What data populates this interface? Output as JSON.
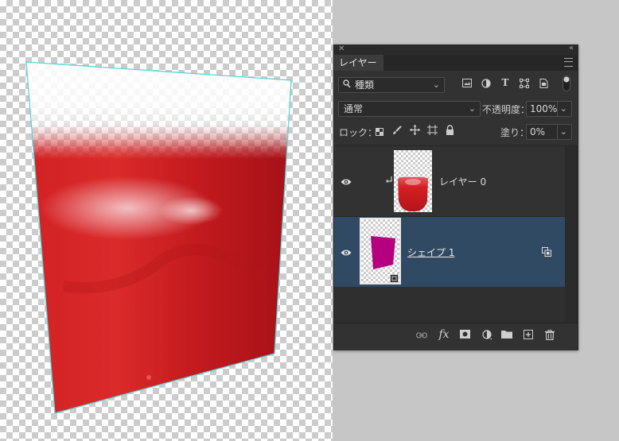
{
  "panel": {
    "tab_label": "レイヤー",
    "filter_kind": "種類",
    "blend_mode": "通常",
    "opacity_label": "不透明度：",
    "opacity_value": "100%",
    "lock_label": "ロック：",
    "fill_label": "塗り：",
    "fill_value": "0%"
  },
  "layers": [
    {
      "name": "レイヤー 0",
      "visible": true,
      "clipped": true,
      "selected": false
    },
    {
      "name": "シェイプ 1",
      "visible": true,
      "clipped": false,
      "selected": true
    }
  ],
  "icons": {
    "filter": [
      "pixel-layer-filter-icon",
      "adjustment-layer-filter-icon",
      "type-layer-filter-icon",
      "shape-layer-filter-icon",
      "smart-object-filter-icon",
      "filter-toggle-icon"
    ],
    "lock": [
      "lock-transparent-pixels-icon",
      "lock-image-pixels-icon",
      "lock-position-icon",
      "lock-artboard-icon",
      "lock-all-icon"
    ],
    "footer": [
      "link-layers-icon",
      "fx-icon",
      "add-mask-icon",
      "new-adjustment-layer-icon",
      "new-group-icon",
      "new-layer-icon",
      "delete-layer-icon"
    ],
    "footer_fx_text": "fx"
  },
  "colors": {
    "panel_bg": "#323232",
    "selected_row": "#314a63",
    "shape_fill": "#b5007f",
    "transform_outline": "#5fd3d6",
    "image_red": "#d42424"
  }
}
